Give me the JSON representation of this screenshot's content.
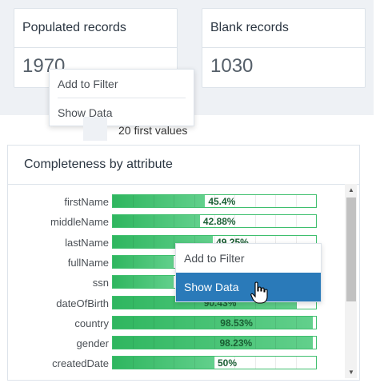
{
  "cards": [
    {
      "title": "Populated records",
      "value": "1970"
    },
    {
      "title": "Blank records",
      "value": "1030"
    }
  ],
  "top_menu": {
    "items": [
      "Add to Filter",
      "Show Data"
    ]
  },
  "first_values_label": "20 first values",
  "panel": {
    "title": "Completeness by attribute",
    "rows": [
      {
        "label": "firstName",
        "pct_text": "45.4%",
        "fraction": 0.454
      },
      {
        "label": "middleName",
        "pct_text": "42.88%",
        "fraction": 0.4288
      },
      {
        "label": "lastName",
        "pct_text": "49.25%",
        "fraction": 0.4925
      },
      {
        "label": "fullName",
        "pct_text": "",
        "fraction": 0.3
      },
      {
        "label": "ssn",
        "pct_text": "",
        "fraction": 0.3
      },
      {
        "label": "dateOfBirth",
        "pct_text": "90.43%",
        "fraction": 0.9043
      },
      {
        "label": "country",
        "pct_text": "98.53%",
        "fraction": 0.9853
      },
      {
        "label": "gender",
        "pct_text": "98.23%",
        "fraction": 0.9823
      },
      {
        "label": "createdDate",
        "pct_text": "50%",
        "fraction": 0.5
      }
    ]
  },
  "bar_menu": {
    "items": [
      "Add to Filter",
      "Show Data"
    ],
    "active_index": 1
  },
  "colors": {
    "bar": "#3fbf6e",
    "active": "#2a7ab9"
  },
  "icons": {
    "cursor": "hand-pointer-icon",
    "scroll_up": "triangle-up-icon",
    "scroll_down": "triangle-down-icon"
  }
}
